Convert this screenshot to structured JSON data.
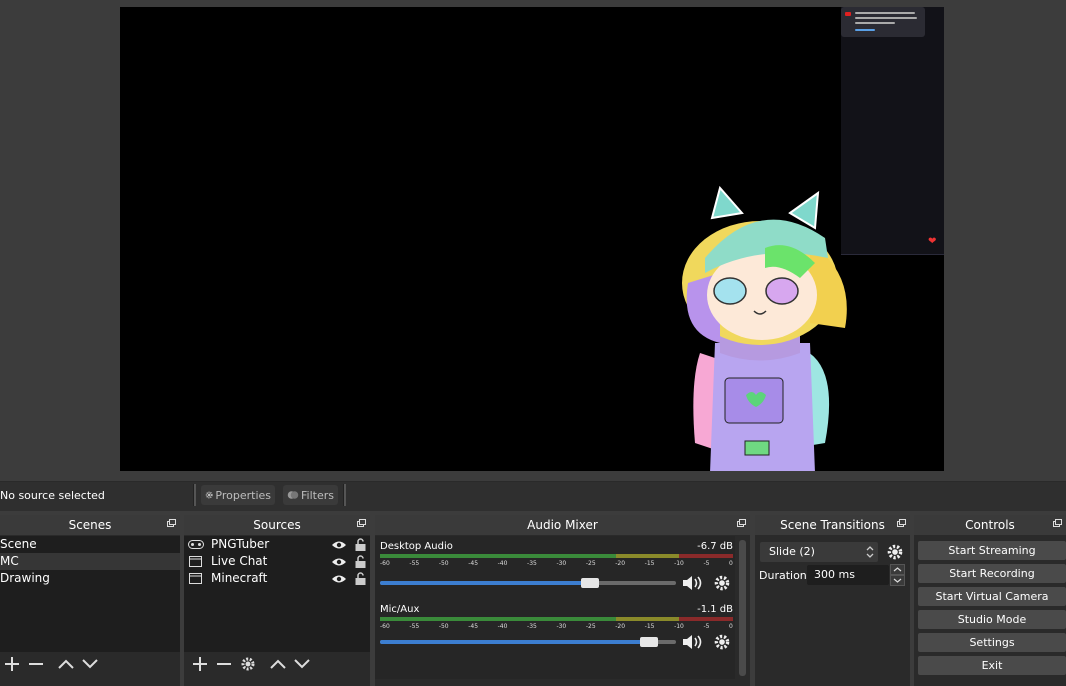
{
  "preview": {
    "chat_popup_visible": true
  },
  "source_toolbar": {
    "status": "No source selected",
    "properties_label": "Properties",
    "filters_label": "Filters"
  },
  "scenes": {
    "title": "Scenes",
    "items": [
      {
        "label": "Scene",
        "selected": false
      },
      {
        "label": "MC",
        "selected": true
      },
      {
        "label": "Drawing",
        "selected": false
      }
    ]
  },
  "sources": {
    "title": "Sources",
    "items": [
      {
        "label": "PNGTuber",
        "icon": "gamepad-icon"
      },
      {
        "label": "Live Chat",
        "icon": "window-icon"
      },
      {
        "label": "Minecraft",
        "icon": "window-icon"
      }
    ]
  },
  "audio_mixer": {
    "title": "Audio Mixer",
    "scale": [
      "-60",
      "-55",
      "-50",
      "-45",
      "-40",
      "-35",
      "-30",
      "-25",
      "-20",
      "-15",
      "-10",
      "-5",
      "0"
    ],
    "channels": [
      {
        "name": "Desktop Audio",
        "db": "-6.7 dB",
        "volume": 0.71
      },
      {
        "name": "Mic/Aux",
        "db": "-1.1 dB",
        "volume": 0.91
      }
    ]
  },
  "scene_transitions": {
    "title": "Scene Transitions",
    "transition": "Slide (2)",
    "duration_label": "Duration",
    "duration_value": "300 ms"
  },
  "controls": {
    "title": "Controls",
    "buttons": [
      "Start Streaming",
      "Start Recording",
      "Start Virtual Camera",
      "Studio Mode",
      "Settings",
      "Exit"
    ]
  },
  "colors": {
    "accent": "#3c7ed0",
    "meter_green": "#3a8a3a",
    "meter_yellow": "#8a8a2a",
    "meter_red": "#8a2a2a"
  }
}
